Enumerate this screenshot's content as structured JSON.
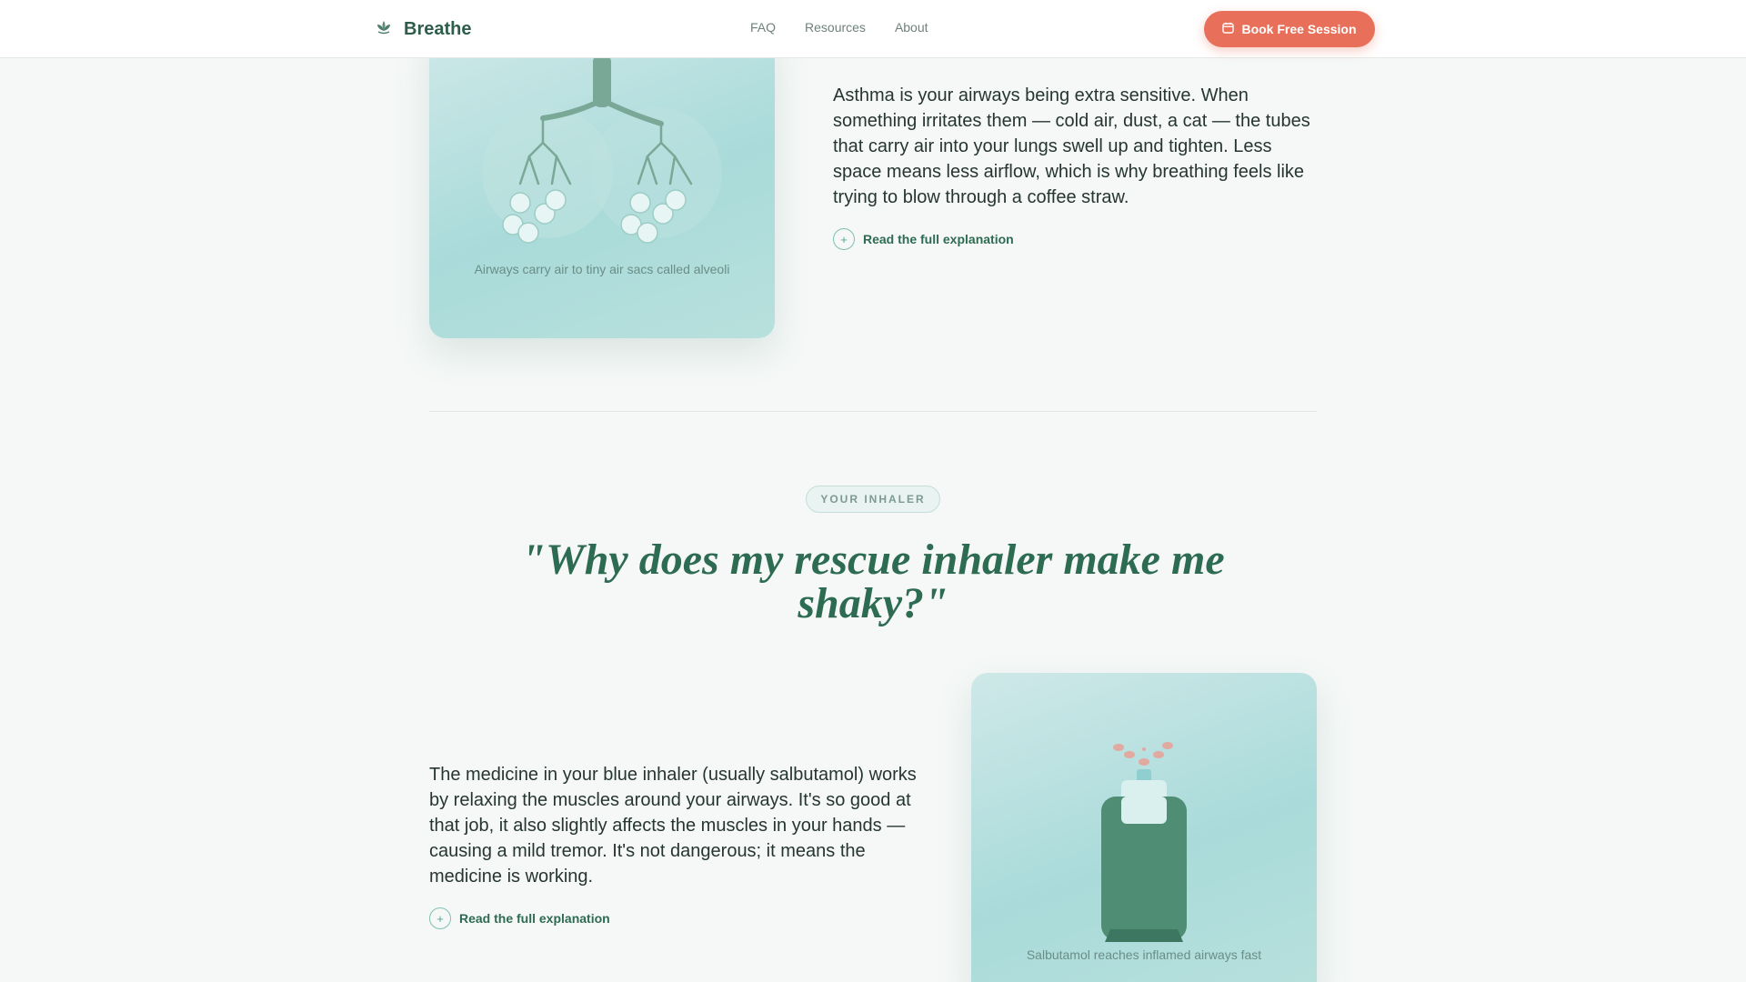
{
  "header": {
    "brand": "Breathe",
    "nav": [
      "FAQ",
      "Resources",
      "About"
    ],
    "cta_label": "Book Free Session"
  },
  "section_airways": {
    "caption": "Airways carry air to tiny air sacs called alveoli",
    "body": "Asthma is your airways being extra sensitive. When something irritates them — cold air, dust, a cat — the tubes that carry air into your lungs swell up and tighten. Less space means less airflow, which is why breathing feels like trying to blow through a coffee straw.",
    "read_more": "Read the full explanation"
  },
  "section_inhaler": {
    "tag": "YOUR INHALER",
    "question": "\"Why does my rescue inhaler make me shaky?\"",
    "body": "The medicine in your blue inhaler (usually salbutamol) works by relaxing the muscles around your airways. It's so good at that job, it also slightly affects the muscles in your hands — causing a mild tremor. It's not dangerous; it means the medicine is working.",
    "read_more": "Read the full explanation",
    "caption": "Salbutamol reaches inflamed airways fast"
  },
  "icons": {
    "brand": "lotus-icon",
    "cta": "calendar-icon",
    "expand": "plus-circle-icon"
  },
  "colors": {
    "brand": "#2e5e4b",
    "accent": "#e8705a",
    "card": "#a9dbda"
  }
}
